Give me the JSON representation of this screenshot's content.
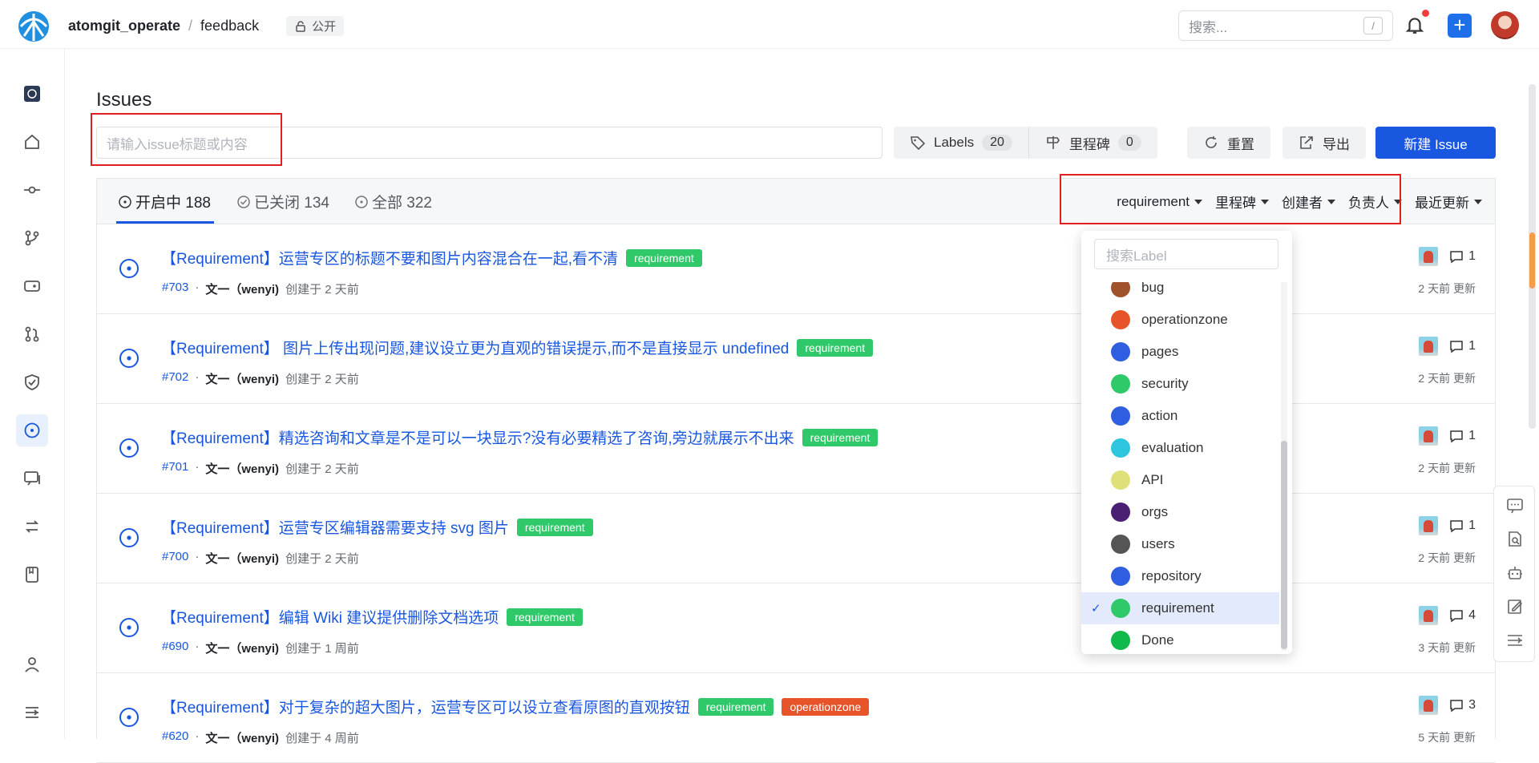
{
  "header": {
    "owner": "atomgit_operate",
    "separator": "/",
    "repo": "feedback",
    "visibility": "公开",
    "search_placeholder": "搜索...",
    "search_shortcut": "/"
  },
  "page": {
    "title": "Issues",
    "search_placeholder": "请输入issue标题或内容"
  },
  "toolbar": {
    "labels": "Labels",
    "labels_count": "20",
    "milestones": "里程碑",
    "milestones_count": "0",
    "reset": "重置",
    "export": "导出",
    "new_issue": "新建 Issue"
  },
  "tabs": {
    "open": "开启中 188",
    "closed": "已关闭 134",
    "all": "全部 322"
  },
  "filters": {
    "label": "requirement",
    "milestone": "里程碑",
    "author": "创建者",
    "assignee": "负责人",
    "sort": "最近更新"
  },
  "issues": [
    {
      "title": "【Requirement】运营专区的标题不要和图片内容混合在一起,看不清",
      "labels": [
        {
          "text": "requirement",
          "color": "#2fc96a"
        }
      ],
      "number": "#703",
      "author": "文一（wenyi)",
      "created": "创建于 2 天前",
      "comments": "1",
      "updated": "2 天前 更新"
    },
    {
      "title": "【Requirement】 图片上传出现问题,建议设立更为直观的错误提示,而不是直接显示 undefined",
      "labels": [
        {
          "text": "requirement",
          "color": "#2fc96a"
        }
      ],
      "number": "#702",
      "author": "文一（wenyi)",
      "created": "创建于 2 天前",
      "comments": "1",
      "updated": "2 天前 更新"
    },
    {
      "title": "【Requirement】精选咨询和文章是不是可以一块显示?没有必要精选了咨询,旁边就展示不出来",
      "labels": [
        {
          "text": "requirement",
          "color": "#2fc96a"
        }
      ],
      "number": "#701",
      "author": "文一（wenyi)",
      "created": "创建于 2 天前",
      "comments": "1",
      "updated": "2 天前 更新"
    },
    {
      "title": "【Requirement】运营专区编辑器需要支持 svg 图片",
      "labels": [
        {
          "text": "requirement",
          "color": "#2fc96a"
        }
      ],
      "number": "#700",
      "author": "文一（wenyi)",
      "created": "创建于 2 天前",
      "comments": "1",
      "updated": "2 天前 更新"
    },
    {
      "title": "【Requirement】编辑 Wiki 建议提供删除文档选项",
      "labels": [
        {
          "text": "requirement",
          "color": "#2fc96a"
        }
      ],
      "number": "#690",
      "author": "文一（wenyi)",
      "created": "创建于 1 周前",
      "comments": "4",
      "updated": "3 天前 更新"
    },
    {
      "title": "【Requirement】对于复杂的超大图片，运营专区可以设立查看原图的直观按钮",
      "labels": [
        {
          "text": "requirement",
          "color": "#2fc96a"
        },
        {
          "text": "operationzone",
          "color": "#e8542a"
        }
      ],
      "number": "#620",
      "author": "文一（wenyi)",
      "created": "创建于 4 周前",
      "comments": "3",
      "updated": "5 天前 更新"
    }
  ],
  "label_dropdown": {
    "search_placeholder": "搜索Label",
    "items": [
      {
        "name": "bug",
        "color": "#a0522d"
      },
      {
        "name": "operationzone",
        "color": "#e8542a"
      },
      {
        "name": "pages",
        "color": "#2f5fe0"
      },
      {
        "name": "security",
        "color": "#2fc96a"
      },
      {
        "name": "action",
        "color": "#2f5fe0"
      },
      {
        "name": "evaluation",
        "color": "#2ec6de"
      },
      {
        "name": "API",
        "color": "#dfe07a"
      },
      {
        "name": "orgs",
        "color": "#4a2075"
      },
      {
        "name": "users",
        "color": "#555555"
      },
      {
        "name": "repository",
        "color": "#2f5fe0"
      },
      {
        "name": "requirement",
        "color": "#2fc96a",
        "selected": true
      },
      {
        "name": "Done",
        "color": "#11b84a"
      }
    ],
    "check": "✓"
  }
}
